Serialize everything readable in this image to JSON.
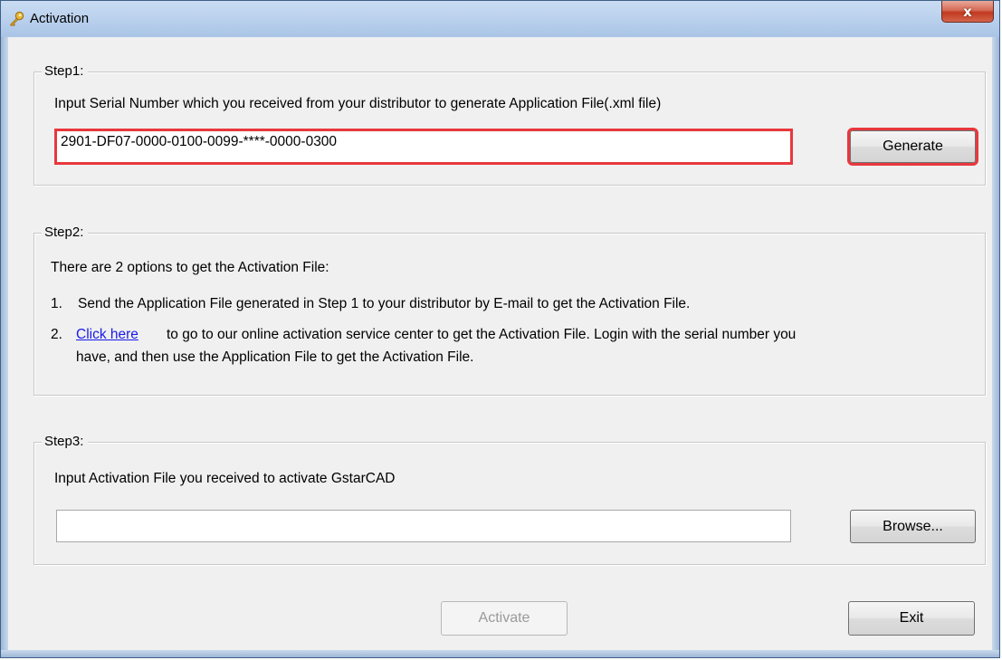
{
  "window": {
    "title": "Activation",
    "close_label": "x"
  },
  "step1": {
    "legend": "Step1:",
    "instruction": "Input Serial Number which you received from your distributor to generate Application File(.xml file)",
    "serial_value": "2901-DF07-0000-0100-0099-****-0000-0300",
    "generate_label": "Generate"
  },
  "step2": {
    "legend": "Step2:",
    "intro": "There are 2 options to get the Activation File:",
    "option1_number": "1.",
    "option1_text": "Send the Application File generated in Step 1 to your distributor by E-mail to get the Activation File.",
    "option2_number": "2.",
    "option2_link": "Click here",
    "option2_text_line1": "to go to our online activation service center to get the Activation File. Login with the serial number you",
    "option2_text_line2": "have, and then use the Application File to get the Activation File."
  },
  "step3": {
    "legend": "Step3:",
    "instruction": "Input Activation File you received to activate GstarCAD",
    "file_value": "",
    "browse_label": "Browse..."
  },
  "footer": {
    "activate_label": "Activate",
    "exit_label": "Exit"
  },
  "colors": {
    "highlight": "#e8383d",
    "link": "#1a1aea"
  },
  "icons": {
    "title_icon": "key-icon"
  }
}
